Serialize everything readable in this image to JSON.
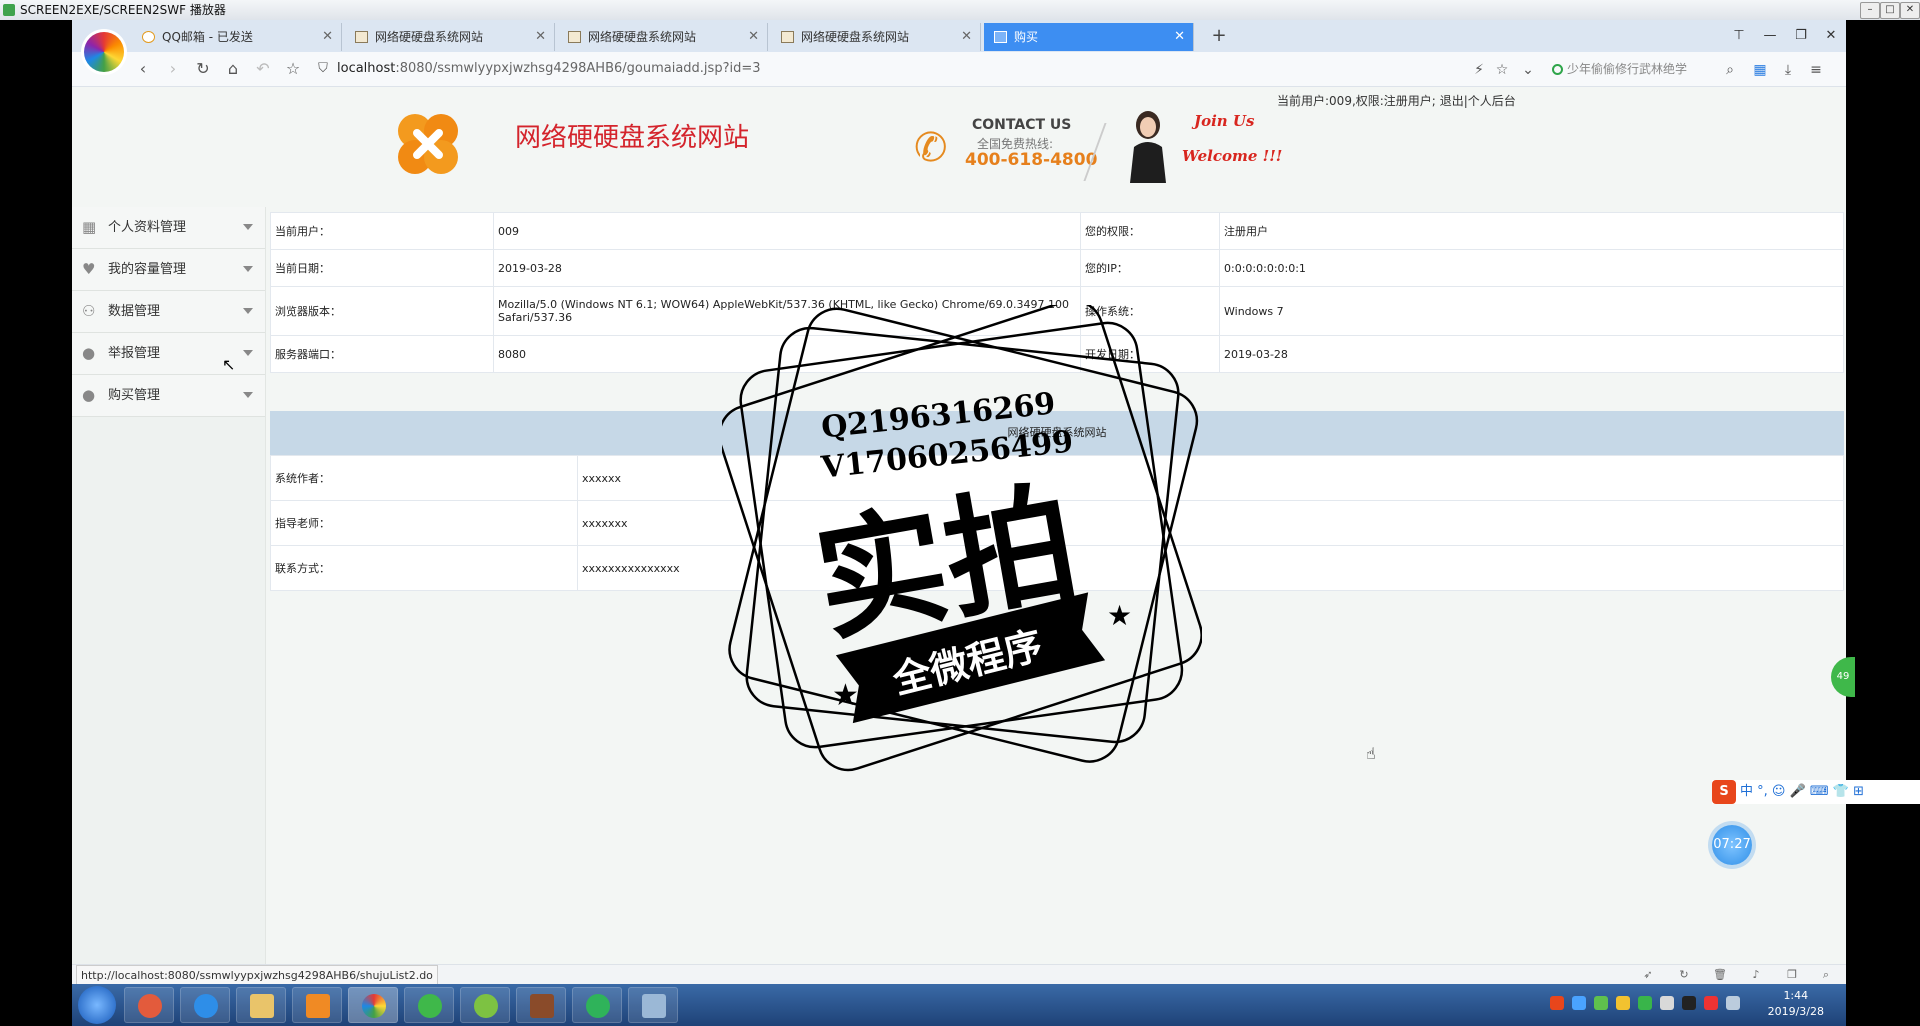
{
  "player": {
    "title": "SCREEN2EXE/SCREEN2SWF 播放器"
  },
  "browser": {
    "tabs": [
      {
        "label": "QQ邮箱 - 已发送",
        "active": false
      },
      {
        "label": "网络硬硬盘系统网站",
        "active": false
      },
      {
        "label": "网络硬硬盘系统网站",
        "active": false
      },
      {
        "label": "网络硬硬盘系统网站",
        "active": false
      },
      {
        "label": "购买",
        "active": true
      }
    ],
    "url_host": "localhost",
    "url_path": ":8080/ssmwlyypxjwzhsg4298AHB6/goumaiadd.jsp?id=3",
    "search_text": "少年偷偷修行武林绝学",
    "status_url": "http://localhost:8080/ssmwlyypxjwzhsg4298AHB6/shujuList2.do"
  },
  "header": {
    "user_line_prefix": "当前用户:009,权限:注册用户;",
    "logout": "退出",
    "backend": "个人后台",
    "site_name": "网络硬硬盘系统网站",
    "contact_title": "CONTACT US",
    "contact_sub": "全国免费热线:",
    "contact_phone": "400-618-4800",
    "join": "Join Us",
    "welcome": "Welcome !!!"
  },
  "sidebar": {
    "items": [
      {
        "label": "个人资料管理",
        "icon": "grid-icon"
      },
      {
        "label": "我的容量管理",
        "icon": "heart-icon"
      },
      {
        "label": "数据管理",
        "icon": "users-icon"
      },
      {
        "label": "举报管理",
        "icon": "user-icon"
      },
      {
        "label": "购买管理",
        "icon": "user-icon"
      }
    ]
  },
  "info": {
    "current_user_label": "当前用户：",
    "current_user": "009",
    "permission_label": "您的权限：",
    "permission": "注册用户",
    "date_label": "当前日期：",
    "date": "2019-03-28",
    "ip_label": "您的IP：",
    "ip": "0:0:0:0:0:0:0:1",
    "browser_label": "浏览器版本：",
    "browser": "Mozilla/5.0 (Windows NT 6.1; WOW64) AppleWebKit/537.36 (KHTML, like Gecko) Chrome/69.0.3497.100 Safari/537.36",
    "os_label": "操作系统：",
    "os": "Windows 7",
    "port_label": "服务器端口：",
    "port": "8080",
    "dev_date_label": "开发日期：",
    "dev_date": "2019-03-28"
  },
  "about": {
    "title": "网络硬硬盘系统网站",
    "author_label": "系统作者：",
    "author": "xxxxxx",
    "teacher_label": "指导老师：",
    "teacher": "xxxxxxx",
    "contact_label": "联系方式：",
    "contact": "xxxxxxxxxxxxxxx"
  },
  "watermark": {
    "line1": "Q2196316269",
    "line2": "V17060256499",
    "big": "实拍",
    "ribbon": "全微程序"
  },
  "overlay": {
    "timer": "07:27",
    "badge": "49",
    "ime_text": "中 °, ☺ 🎤 ⌨ 👕 ⊞"
  },
  "taskbar": {
    "time": "1:44",
    "date": "2019/3/28"
  },
  "colors": {
    "accent": "#3d8ef2",
    "brand_red": "#d4242c",
    "orange": "#e6801c",
    "about_head": "#c6d8e7"
  }
}
